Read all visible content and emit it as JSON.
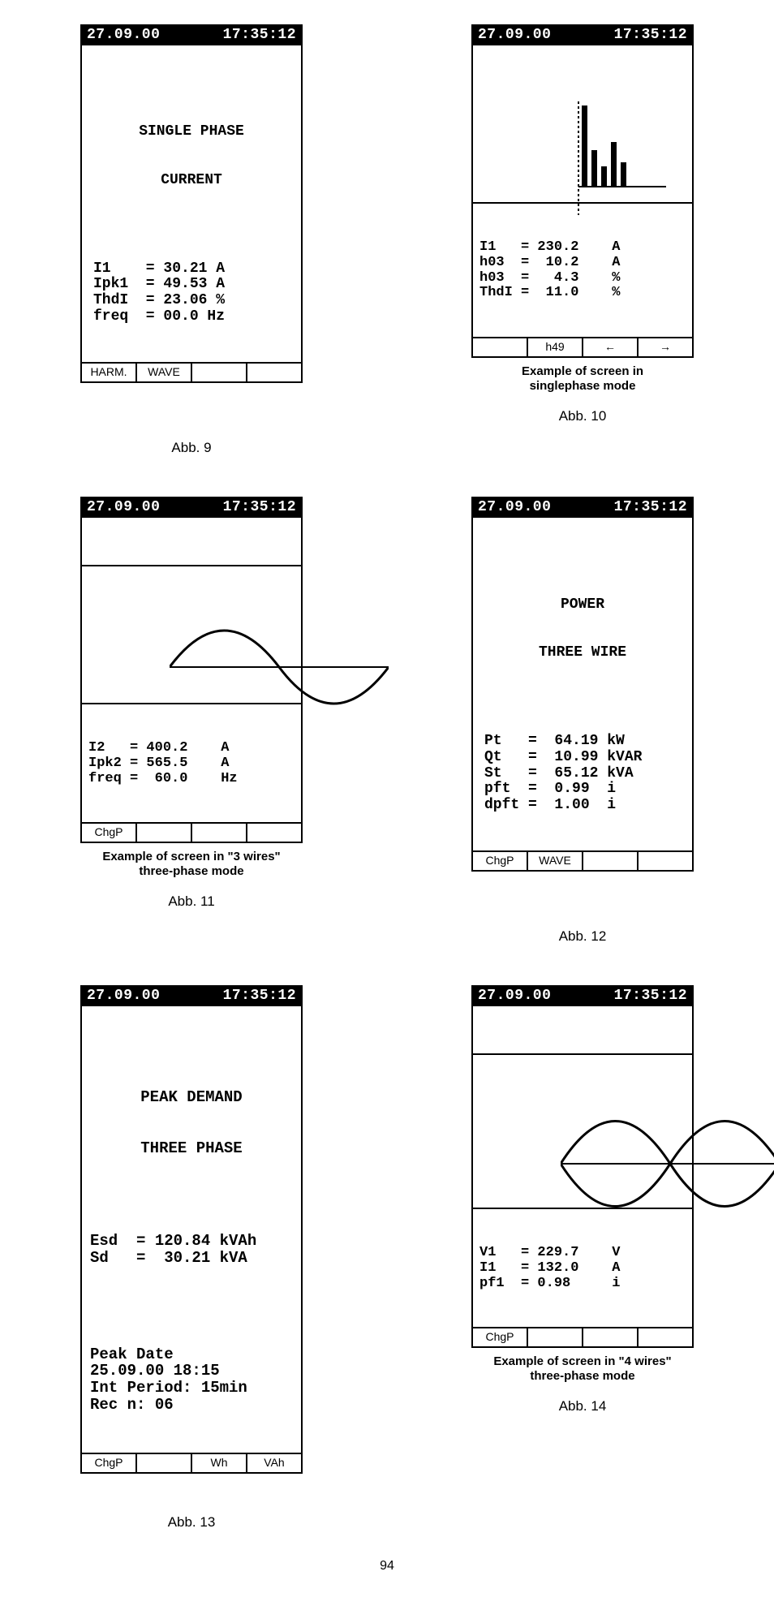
{
  "common": {
    "date": "27.09.00",
    "time": "17:35:12"
  },
  "fig9": {
    "title1": "SINGLE PHASE",
    "title2": "CURRENT",
    "rows": "I1    = 30.21 A\nIpk1  = 49.53 A\nThdI  = 23.06 %\nfreq  = 00.0 Hz",
    "sk1": "HARM.",
    "sk2": "WAVE",
    "sk3": "",
    "sk4": "",
    "label": "Abb. 9"
  },
  "fig10": {
    "rows": "I1   = 230.2    A\nh03  =  10.2    A\nh03  =   4.3    %\nThdI =  11.0    %",
    "sk1": "",
    "sk2": "h49",
    "sk3": "←",
    "sk4": "→",
    "caption1": "Example of screen in",
    "caption2": "singlephase mode",
    "label": "Abb. 10"
  },
  "fig11": {
    "rows": "I2   = 400.2    A\nIpk2 = 565.5    A\nfreq =  60.0    Hz",
    "sk1": "ChgP",
    "sk2": "",
    "sk3": "",
    "sk4": "",
    "caption1": "Example of screen in \"3 wires\"",
    "caption2": "three-phase mode",
    "label": "Abb. 11"
  },
  "fig12": {
    "title1": "POWER",
    "title2": "THREE WIRE",
    "rows": "Pt   =  64.19 kW\nQt   =  10.99 kVAR\nSt   =  65.12 kVA\npft  =  0.99  i\ndpft =  1.00  i",
    "sk1": "ChgP",
    "sk2": "WAVE",
    "sk3": "",
    "sk4": "",
    "label": "Abb. 12"
  },
  "fig13": {
    "title1": "PEAK DEMAND",
    "title2": "THREE PHASE",
    "rows1": "Esd  = 120.84 kVAh\nSd   =  30.21 kVA",
    "rows2": "Peak Date\n25.09.00 18:15\nInt Period: 15min\nRec n: 06",
    "sk1": "ChgP",
    "sk2": "",
    "sk3": "Wh",
    "sk4": "VAh",
    "label": "Abb. 13"
  },
  "fig14": {
    "rows": "V1   = 229.7    V\nI1   = 132.0    A\npf1  = 0.98     i",
    "sk1": "ChgP",
    "sk2": "",
    "sk3": "",
    "sk4": "",
    "caption1": "Example of screen in \"4 wires\"",
    "caption2": "three-phase mode",
    "label": "Abb. 14"
  },
  "page": "94"
}
